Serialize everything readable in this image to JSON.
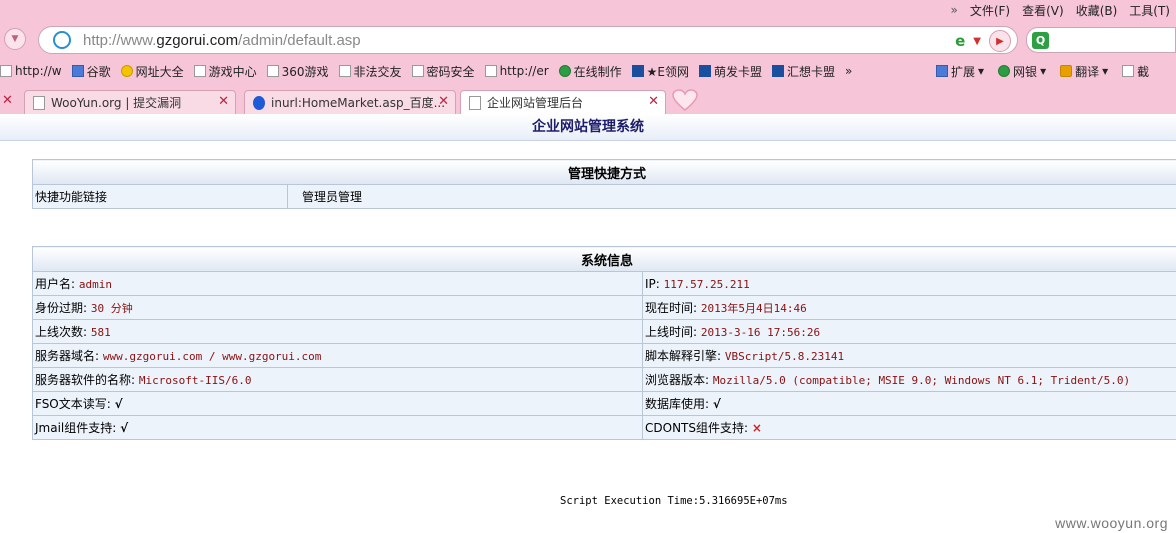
{
  "browser": {
    "menu": {
      "more": "»",
      "items": [
        "文件(F)",
        "查看(V)",
        "收藏(B)",
        "工具(T)"
      ]
    },
    "address": {
      "prefix": "http://www.",
      "domain": "gzgorui.com",
      "path": "/admin/default.asp"
    },
    "favorites": [
      {
        "label": "http://w",
        "icon": "page-icon"
      },
      {
        "label": "谷歌",
        "icon": "google-icon"
      },
      {
        "label": "网址大全",
        "icon": "yellow-icon"
      },
      {
        "label": "游戏中心",
        "icon": "page-icon"
      },
      {
        "label": "360游戏",
        "icon": "page-icon"
      },
      {
        "label": "非法交友",
        "icon": "page-icon"
      },
      {
        "label": "密码安全",
        "icon": "page-icon"
      },
      {
        "label": "http://er",
        "icon": "page-icon"
      },
      {
        "label": "在线制作",
        "icon": "leaf-icon"
      },
      {
        "label": "★E领网",
        "icon": "card-icon"
      },
      {
        "label": "萌发卡盟",
        "icon": "card-icon"
      },
      {
        "label": "汇想卡盟",
        "icon": "card-icon"
      }
    ],
    "favorites_more": "»",
    "toolbar_right": [
      "扩展",
      "网银",
      "翻译",
      "截"
    ],
    "tabs": [
      {
        "title": "WooYun.org | 提交漏洞"
      },
      {
        "title": "inurl:HomeMarket.asp_百度..."
      },
      {
        "title": "企业网站管理后台"
      }
    ]
  },
  "page": {
    "site_title": "企业网站管理系统",
    "shortcuts": {
      "title": "管理快捷方式",
      "label": "快捷功能链接",
      "link": "管理员管理"
    },
    "sysinfo": {
      "title": "系统信息",
      "rows": [
        [
          {
            "k": "用户名:",
            "v": "admin"
          },
          {
            "k": "IP:",
            "v": "117.57.25.211"
          }
        ],
        [
          {
            "k": "身份过期:",
            "v": "30 分钟"
          },
          {
            "k": "现在时间:",
            "v": "2013年5月4日14:46"
          }
        ],
        [
          {
            "k": "上线次数:",
            "v": "581"
          },
          {
            "k": "上线时间:",
            "v": "2013-3-16 17:56:26"
          }
        ],
        [
          {
            "k": "服务器域名:",
            "v": "www.gzgorui.com / www.gzgorui.com"
          },
          {
            "k": "脚本解释引擎:",
            "v": "VBScript/5.8.23141"
          }
        ],
        [
          {
            "k": "服务器软件的名称:",
            "v": "Microsoft-IIS/6.0"
          },
          {
            "k": "浏览器版本:",
            "v": "Mozilla/5.0 (compatible; MSIE 9.0; Windows NT 6.1; Trident/5.0)"
          }
        ],
        [
          {
            "k": "FSO文本读写:",
            "v": "√"
          },
          {
            "k": "数据库使用:",
            "v": "√"
          }
        ],
        [
          {
            "k": "Jmail组件支持:",
            "v": "√"
          },
          {
            "k": "CDONTS组件支持:",
            "v": "×"
          }
        ]
      ]
    },
    "exec_time": "Script Execution Time:5.316695E+07ms",
    "watermark": "www.wooyun.org"
  }
}
